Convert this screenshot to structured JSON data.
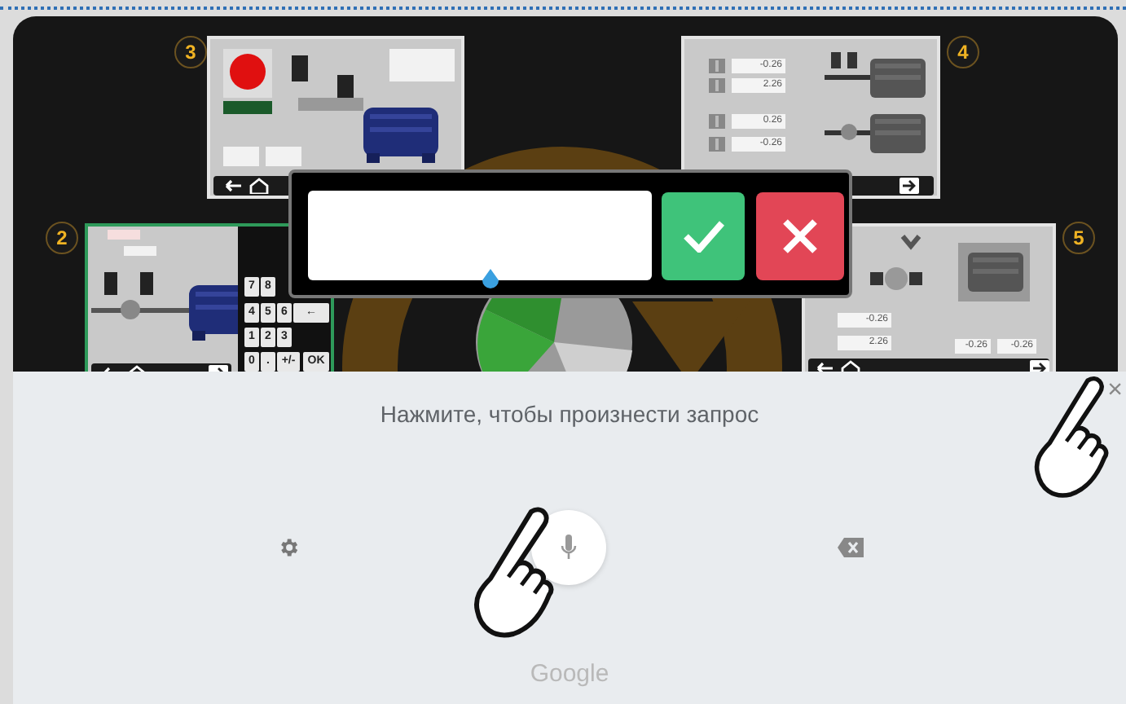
{
  "steps": [
    {
      "number": "3",
      "kind": "overview",
      "selected": false
    },
    {
      "number": "4",
      "kind": "readings",
      "selected": false,
      "values": [
        "-0.26",
        "2.26",
        "0.26",
        "-0.26"
      ]
    },
    {
      "number": "2",
      "kind": "keypad",
      "selected": true,
      "keys": [
        "7",
        "8",
        "4",
        "5",
        "6",
        "←",
        "1",
        "2",
        "3",
        "0",
        ".",
        "+/-",
        "OK"
      ]
    },
    {
      "number": "5",
      "kind": "result",
      "selected": false,
      "values": [
        "-0.26",
        "2.26",
        "-0.26",
        "-0.26"
      ]
    }
  ],
  "voice_input": {
    "prompt": "Нажмите, чтобы произнести запрос",
    "close": "×",
    "brand": "Google"
  }
}
